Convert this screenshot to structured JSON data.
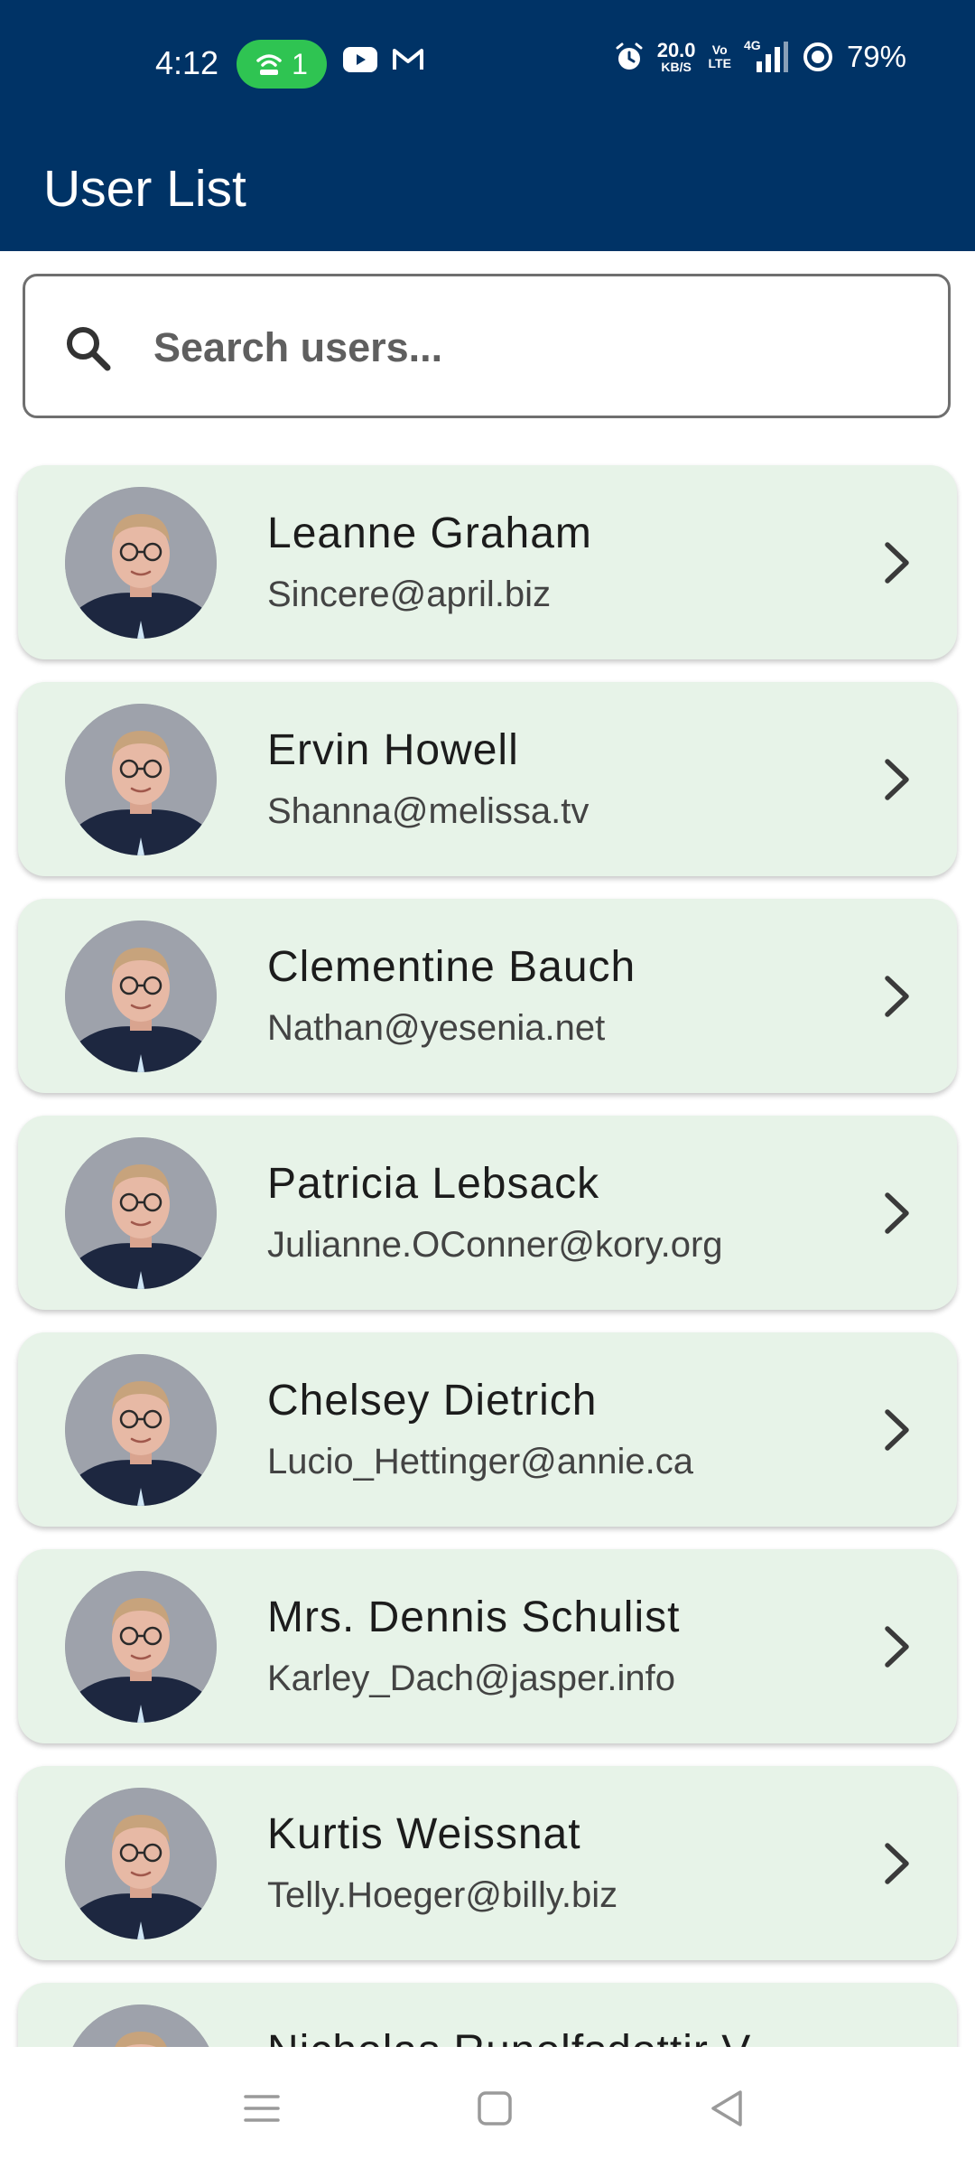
{
  "status_bar": {
    "time": "4:12",
    "hotspot_count": "1",
    "net_speed_value": "20.0",
    "net_speed_unit": "KB/S",
    "volte_top": "Vo",
    "volte_bottom": "LTE",
    "network_type": "4G",
    "battery": "79%"
  },
  "app_bar": {
    "title": "User List"
  },
  "search": {
    "placeholder": "Search users...",
    "value": ""
  },
  "users": [
    {
      "name": "Leanne Graham",
      "email": "Sincere@april.biz"
    },
    {
      "name": "Ervin Howell",
      "email": "Shanna@melissa.tv"
    },
    {
      "name": "Clementine Bauch",
      "email": "Nathan@yesenia.net"
    },
    {
      "name": "Patricia Lebsack",
      "email": "Julianne.OConner@kory.org"
    },
    {
      "name": "Chelsey Dietrich",
      "email": "Lucio_Hettinger@annie.ca"
    },
    {
      "name": "Mrs. Dennis Schulist",
      "email": "Karley_Dach@jasper.info"
    },
    {
      "name": "Kurtis Weissnat",
      "email": "Telly.Hoeger@billy.biz"
    },
    {
      "name": "Nicholas Runolfsdottir V",
      "email": ""
    }
  ],
  "icons": {
    "search": "search-icon",
    "chevron": "chevron-right-icon",
    "nav_menu": "menu-icon",
    "nav_home": "home-square-icon",
    "nav_back": "back-triangle-icon"
  },
  "colors": {
    "app_bar": "#003366",
    "card_background": "#e7f3e8",
    "hotspot": "#2fc452"
  }
}
